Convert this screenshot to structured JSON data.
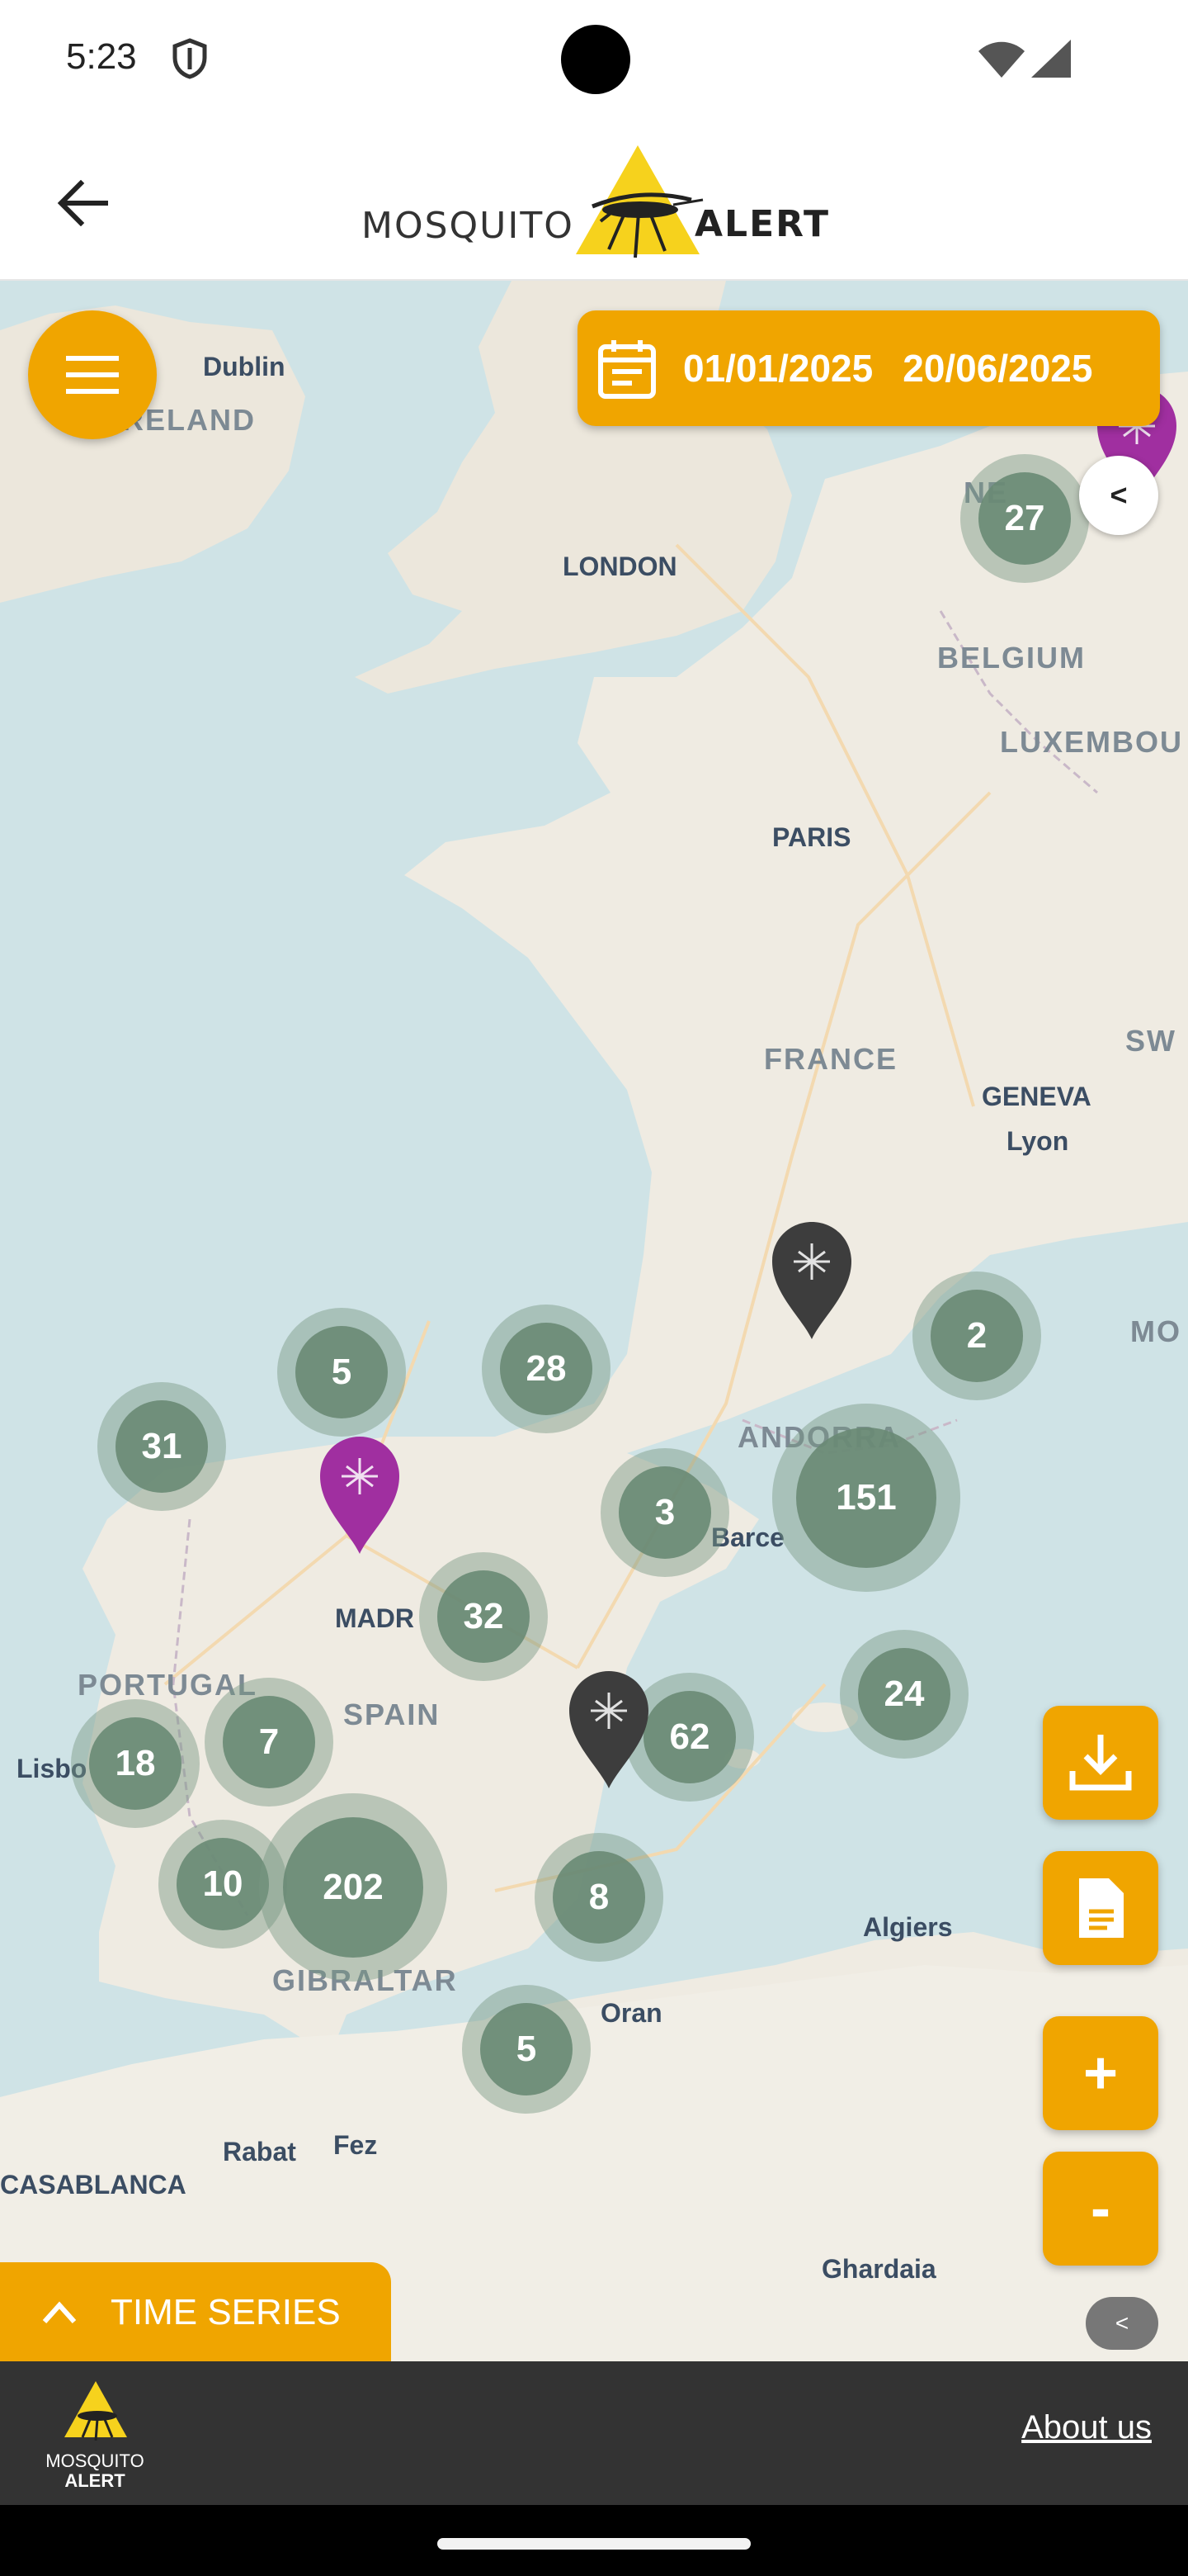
{
  "status_bar": {
    "time": "5:23"
  },
  "header": {
    "logo_left": "MOSQUITO",
    "logo_right": "ALERT"
  },
  "map": {
    "date_from": "01/01/2025",
    "date_to": "20/06/2025",
    "collapse_label": "<",
    "attribution_label": "<",
    "places": [
      {
        "label": "Dublin",
        "style": "small"
      },
      {
        "label": "RELAND",
        "style": "gray"
      },
      {
        "label": "LONDON",
        "style": "small"
      },
      {
        "label": "BELGIUM",
        "style": "gray"
      },
      {
        "label": "LUXEMBOU",
        "style": "gray"
      },
      {
        "label": "PARIS",
        "style": "small"
      },
      {
        "label": "FRANCE",
        "style": "gray"
      },
      {
        "label": "SW",
        "style": "gray"
      },
      {
        "label": "GENEVA",
        "style": "small"
      },
      {
        "label": "Lyon",
        "style": "small"
      },
      {
        "label": "MO",
        "style": "gray"
      },
      {
        "label": "ANDORRA",
        "style": "gray"
      },
      {
        "label": "Barce",
        "style": "small"
      },
      {
        "label": "MADR",
        "style": "small"
      },
      {
        "label": "PORTUGAL",
        "style": "gray"
      },
      {
        "label": "SPAIN",
        "style": "gray"
      },
      {
        "label": "Lisbo",
        "style": "small"
      },
      {
        "label": "GIBRALTAR",
        "style": "gray"
      },
      {
        "label": "Algiers",
        "style": "small"
      },
      {
        "label": "Oran",
        "style": "small"
      },
      {
        "label": "Rabat",
        "style": "small"
      },
      {
        "label": "Fez",
        "style": "small"
      },
      {
        "label": "CASABLANCA",
        "style": "small"
      },
      {
        "label": "Ghardaia",
        "style": "small"
      },
      {
        "label": "NE",
        "style": "gray"
      }
    ],
    "clusters": [
      "27",
      "2",
      "5",
      "28",
      "31",
      "3",
      "151",
      "32",
      "24",
      "62",
      "7",
      "18",
      "10",
      "202",
      "8",
      "5"
    ],
    "pins": [
      {
        "color": "#a02fa0"
      },
      {
        "color": "#3d3d3d"
      },
      {
        "color": "#a02fa0"
      },
      {
        "color": "#3d3d3d"
      }
    ]
  },
  "controls": {
    "zoom_in": "+",
    "zoom_out": "-",
    "time_series": "TIME SERIES"
  },
  "footer": {
    "logo_top": "MOSQUITO",
    "logo_bottom": "ALERT",
    "about": "About us"
  },
  "colors": {
    "accent": "#f0a500",
    "cluster": "#698a74",
    "pin_purple": "#a02fa0",
    "pin_dark": "#3d3d3d",
    "footer": "#333333"
  }
}
